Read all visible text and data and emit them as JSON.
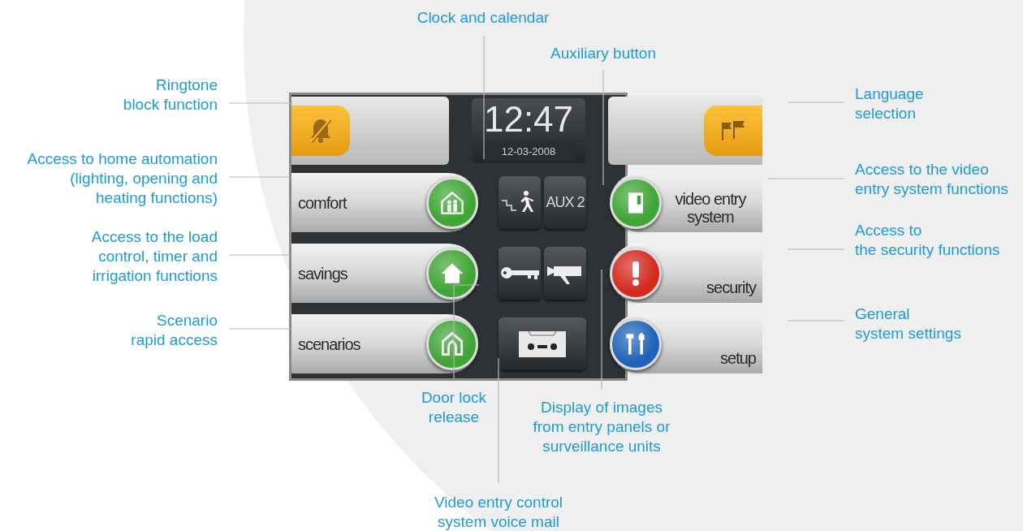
{
  "screen": {
    "clock": {
      "time": "12:47",
      "date": "12-03-2008"
    },
    "aux_button": {
      "label": "AUX 2"
    },
    "left_menu": [
      {
        "label": "comfort",
        "color": "#3fa535"
      },
      {
        "label": "savings",
        "color": "#3fa535"
      },
      {
        "label": "scenarios",
        "color": "#3fa535"
      }
    ],
    "right_menu": [
      {
        "label": "video entry system",
        "color": "#3fa535"
      },
      {
        "label": "security",
        "color": "#d42a1e"
      },
      {
        "label": "setup",
        "color": "#1f63b8"
      }
    ]
  },
  "callouts": [
    {
      "text": "Clock and calendar"
    },
    {
      "text": "Auxiliary button"
    },
    {
      "text": "Ringtone\nblock function"
    },
    {
      "text": "Access to home automation\n(lighting, opening and\nheating functions)"
    },
    {
      "text": "Access to the load\ncontrol, timer and\nirrigation functions"
    },
    {
      "text": "Scenario\nrapid access"
    },
    {
      "text": "Language\nselection"
    },
    {
      "text": "Access to the video\nentry system functions"
    },
    {
      "text": "Access to\nthe security functions"
    },
    {
      "text": "General\nsystem settings"
    },
    {
      "text": "Door lock\nrelease"
    },
    {
      "text": "Display of images\nfrom entry panels or\nsurveillance units"
    },
    {
      "text": "Video entry control\nsystem voice mail"
    }
  ]
}
